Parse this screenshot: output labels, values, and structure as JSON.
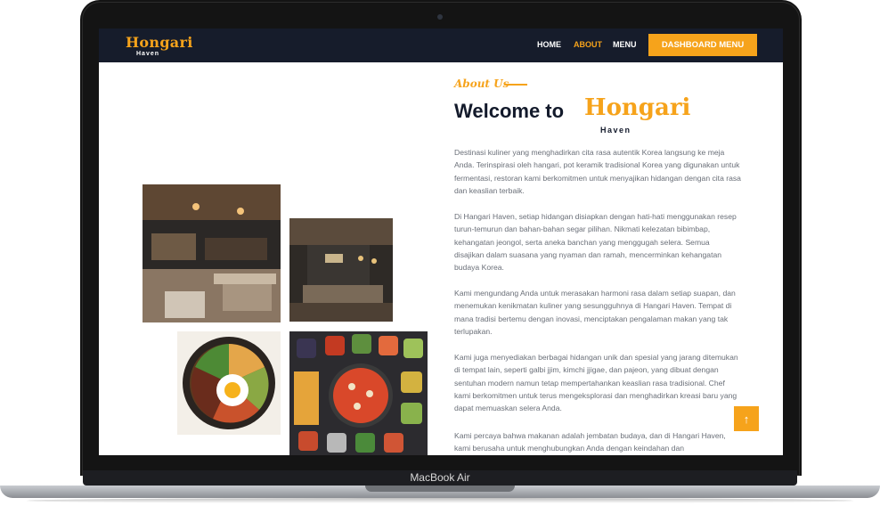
{
  "device": {
    "label": "MacBook Air"
  },
  "nav": {
    "logo_text": "Hongari",
    "logo_sub": "Haven",
    "links": [
      {
        "label": "HOME",
        "active": false
      },
      {
        "label": "ABOUT",
        "active": true
      },
      {
        "label": "MENU",
        "active": false
      }
    ],
    "cta_label": "DASHBOARD MENU"
  },
  "about": {
    "tag": "About Us",
    "welcome": "Welcome to",
    "logo_text": "Hongari",
    "logo_sub": "Haven",
    "paragraphs": [
      "Destinasi kuliner yang menghadirkan cita rasa autentik Korea langsung ke meja Anda. Terinspirasi oleh hangari, pot keramik tradisional Korea yang digunakan untuk fermentasi, restoran kami berkomitmen untuk menyajikan hidangan dengan cita rasa dan keaslian terbaik.",
      "Di Hangari Haven, setiap hidangan disiapkan dengan hati-hati menggunakan resep turun-temurun dan bahan-bahan segar pilihan. Nikmati kelezatan bibimbap, kehangatan jeongol, serta aneka banchan yang menggugah selera. Semua disajikan dalam suasana yang nyaman dan ramah, mencerminkan kehangatan budaya Korea.",
      "Kami mengundang Anda untuk merasakan harmoni rasa dalam setiap suapan, dan menemukan kenikmatan kuliner yang sesungguhnya di Hangari Haven. Tempat di mana tradisi bertemu dengan inovasi, menciptakan pengalaman makan yang tak terlupakan.",
      "Kami juga menyediakan berbagai hidangan unik dan spesial yang jarang ditemukan di tempat lain, seperti galbi jjim, kimchi jjigae, dan pajeon, yang dibuat dengan sentuhan modern namun tetap mempertahankan keaslian rasa tradisional. Chef kami berkomitmen untuk terus mengeksplorasi dan menghadirkan kreasi baru yang dapat memuaskan selera Anda.",
      "Kami percaya bahwa makanan adalah jembatan budaya, dan di Hangari Haven, kami berusaha untuk menghubungkan Anda dengan keindahan dan"
    ]
  },
  "back_to_top": "↑",
  "colors": {
    "accent": "#f6a31b",
    "nav_bg": "#161c2b",
    "heading": "#131a2b",
    "body_text": "#6a6f78"
  },
  "photos": [
    "restaurant-interior-photo",
    "private-dining-room-photo",
    "bibimbap-photo",
    "korean-banchan-spread-photo"
  ]
}
